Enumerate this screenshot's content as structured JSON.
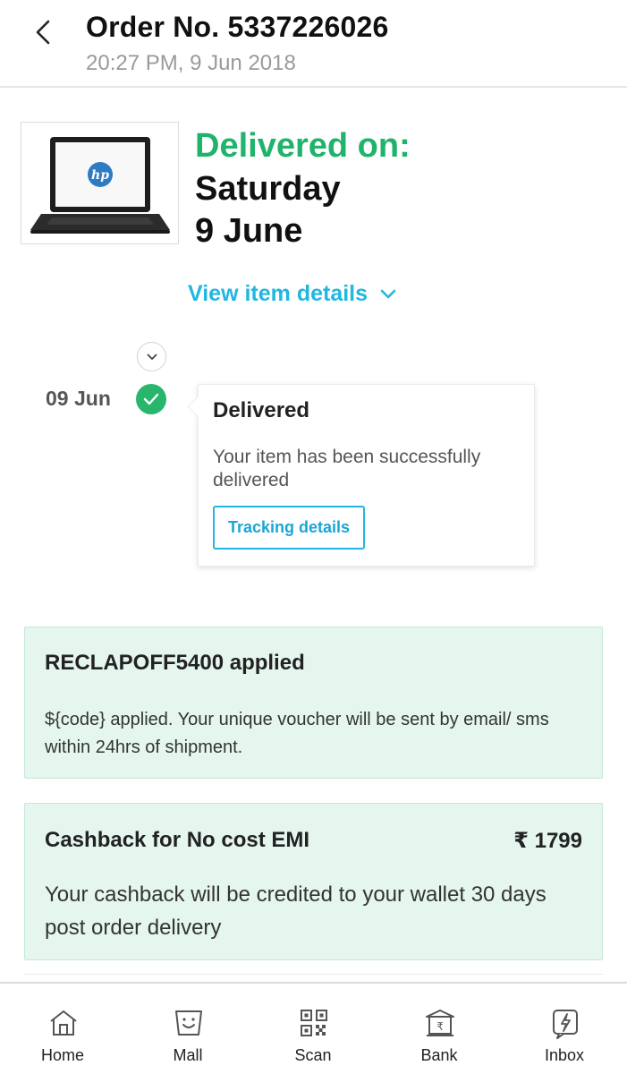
{
  "header": {
    "title": "Order No. 5337226026",
    "subtitle": "20:27 PM, 9 Jun 2018"
  },
  "product": {
    "image_icon": "laptop-image",
    "delivered_label": "Delivered on:",
    "delivered_day": "Saturday",
    "delivered_date": "9 June",
    "view_details_label": "View item details"
  },
  "timeline": {
    "date": "09 Jun",
    "status_title": "Delivered",
    "status_message": "Your item has been successfully delivered",
    "tracking_button": "Tracking details"
  },
  "voucher": {
    "title": "RECLAPOFF5400 applied",
    "message": "${code} applied. Your unique voucher will be sent by email/ sms within 24hrs of shipment."
  },
  "cashback": {
    "title": "Cashback for No cost EMI",
    "amount": "₹ 1799",
    "message": "Your cashback will be credited to your wallet 30 days post order delivery"
  },
  "bottom_nav": {
    "items": [
      {
        "label": "Home",
        "icon": "home-icon"
      },
      {
        "label": "Mall",
        "icon": "mall-icon"
      },
      {
        "label": "Scan",
        "icon": "qr-scan-icon"
      },
      {
        "label": "Bank",
        "icon": "bank-icon"
      },
      {
        "label": "Inbox",
        "icon": "inbox-icon"
      }
    ]
  },
  "colors": {
    "accent_green": "#20b36b",
    "link_blue": "#20b7e0",
    "box_background": "#e5f6ee"
  }
}
